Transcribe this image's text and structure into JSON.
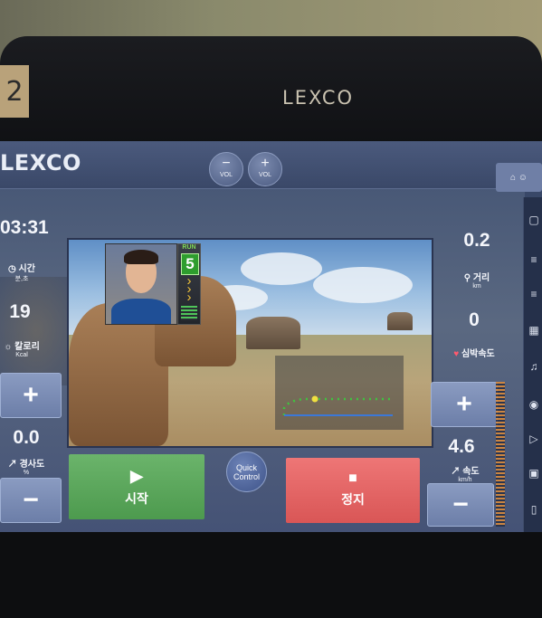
{
  "sticker": {
    "text": "2"
  },
  "brand": {
    "label": "LEXCO"
  },
  "topbar": {
    "logo": "LEXCO",
    "vol_down": {
      "symbol": "−",
      "label": "VOL"
    },
    "vol_up": {
      "symbol": "+",
      "label": "VOL"
    },
    "home_icon": "home-icon",
    "user_icon": "user-icon"
  },
  "left_stats": {
    "time": {
      "value": "03:31",
      "label": "시간",
      "unit": "분,초"
    },
    "calories": {
      "value": "19",
      "label": "칼로리",
      "unit": "Kcal"
    },
    "incline": {
      "value": "0.0",
      "label": "경사도",
      "unit": "%"
    }
  },
  "right_stats": {
    "distance": {
      "value": "0.2",
      "label": "거리",
      "unit": "km"
    },
    "heart_rate": {
      "value": "0",
      "label": "심박속도"
    },
    "speed": {
      "value": "4.6",
      "label": "속도",
      "unit": "km/h"
    }
  },
  "video": {
    "run_label": "RUN",
    "run_number": "5"
  },
  "controls": {
    "start_label": "시작",
    "start_icon": "play-icon",
    "stop_label": "정지",
    "stop_icon": "stop-icon",
    "quick_control": "Quick Control",
    "plus": "+",
    "minus": "−"
  },
  "colors": {
    "start": "#5fa860",
    "stop": "#e46a6a",
    "accent": "#6c7ea8"
  }
}
